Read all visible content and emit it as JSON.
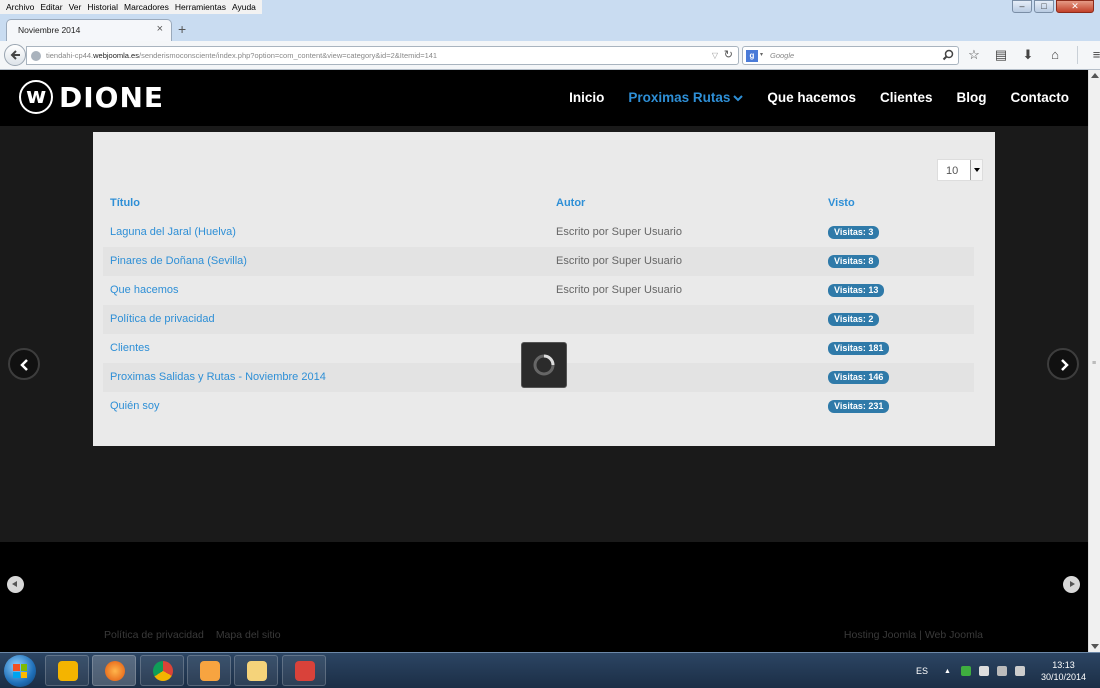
{
  "browser": {
    "menus": [
      "Archivo",
      "Editar",
      "Ver",
      "Historial",
      "Marcadores",
      "Herramientas",
      "Ayuda"
    ],
    "tab_title": "Noviembre 2014",
    "url_prefix": "tiendahi-cp44.",
    "url_domain": "webjoomla.es",
    "url_path": "/senderismoconsciente/index.php?option=com_content&view=category&id=2&Itemid=141",
    "search_placeholder": "Google"
  },
  "site": {
    "brand": "DIONE",
    "logo_mark": "w",
    "nav": [
      {
        "label": "Inicio",
        "active": false
      },
      {
        "label": "Proximas Rutas",
        "active": true
      },
      {
        "label": "Que hacemos",
        "active": false
      },
      {
        "label": "Clientes",
        "active": false
      },
      {
        "label": "Blog",
        "active": false
      },
      {
        "label": "Contacto",
        "active": false
      }
    ],
    "accent_color": "#2e8fd6"
  },
  "list": {
    "limit_value": "10",
    "headers": {
      "title": "Título",
      "author": "Autor",
      "hits": "Visto"
    },
    "rows": [
      {
        "title": "Laguna del Jaral (Huelva)",
        "author": "Escrito por Super Usuario",
        "hits": "Visitas: 3"
      },
      {
        "title": "Pinares de Doñana (Sevilla)",
        "author": "Escrito por Super Usuario",
        "hits": "Visitas: 8"
      },
      {
        "title": "Que hacemos",
        "author": "Escrito por Super Usuario",
        "hits": "Visitas: 13"
      },
      {
        "title": "Política de privacidad",
        "author": "",
        "hits": "Visitas: 2"
      },
      {
        "title": "Clientes",
        "author": "",
        "hits": "Visitas: 181"
      },
      {
        "title": "Proximas Salidas y Rutas - Noviembre 2014",
        "author": "",
        "hits": "Visitas: 146"
      },
      {
        "title": "Quién soy",
        "author": "",
        "hits": "Visitas: 231"
      }
    ]
  },
  "footer": {
    "links": [
      "Política de privacidad",
      "Mapa del sitio"
    ],
    "credit": "Hosting Joomla | Web Joomla"
  },
  "taskbar": {
    "language": "ES",
    "time": "13:13",
    "date": "30/10/2014"
  }
}
